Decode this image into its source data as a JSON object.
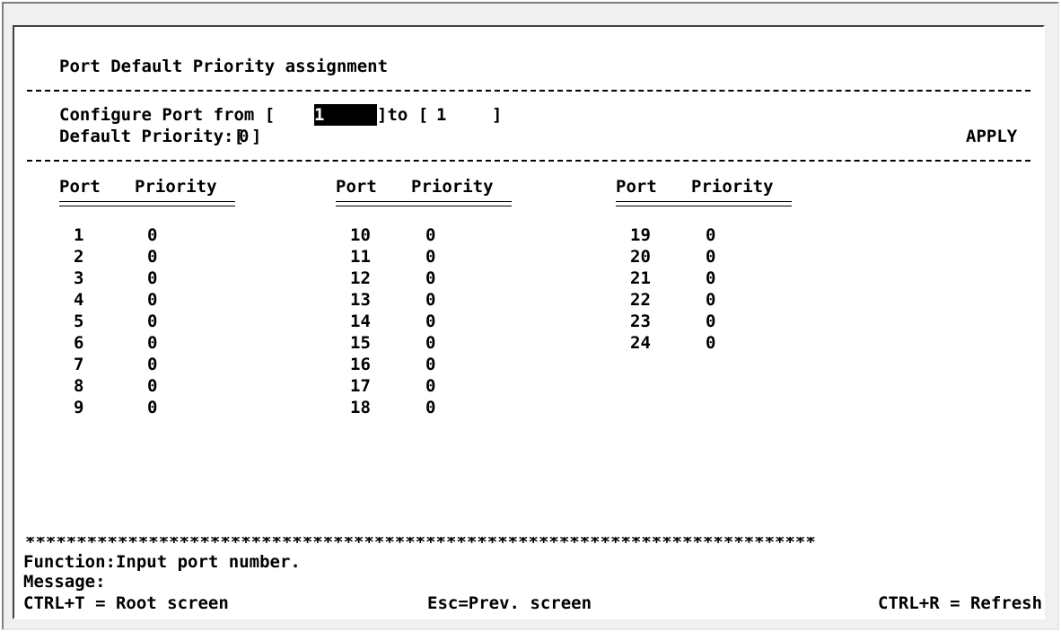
{
  "screen": {
    "title": "Port Default Priority assignment",
    "configure": {
      "label_from": "Configure Port from [",
      "from_value": "1",
      "label_to": "]to [",
      "to_value": "1   ",
      "label_close": "]"
    },
    "default_priority": {
      "label": "Default Priority:[",
      "value": "0",
      "label_close": "]"
    },
    "apply_label": "APPLY",
    "table": {
      "header_port": "Port",
      "header_priority": "Priority",
      "columns": [
        {
          "rows": [
            {
              "port": "1",
              "priority": "0"
            },
            {
              "port": "2",
              "priority": "0"
            },
            {
              "port": "3",
              "priority": "0"
            },
            {
              "port": "4",
              "priority": "0"
            },
            {
              "port": "5",
              "priority": "0"
            },
            {
              "port": "6",
              "priority": "0"
            },
            {
              "port": "7",
              "priority": "0"
            },
            {
              "port": "8",
              "priority": "0"
            },
            {
              "port": "9",
              "priority": "0"
            }
          ]
        },
        {
          "rows": [
            {
              "port": "10",
              "priority": "0"
            },
            {
              "port": "11",
              "priority": "0"
            },
            {
              "port": "12",
              "priority": "0"
            },
            {
              "port": "13",
              "priority": "0"
            },
            {
              "port": "14",
              "priority": "0"
            },
            {
              "port": "15",
              "priority": "0"
            },
            {
              "port": "16",
              "priority": "0"
            },
            {
              "port": "17",
              "priority": "0"
            },
            {
              "port": "18",
              "priority": "0"
            }
          ]
        },
        {
          "rows": [
            {
              "port": "19",
              "priority": "0"
            },
            {
              "port": "20",
              "priority": "0"
            },
            {
              "port": "21",
              "priority": "0"
            },
            {
              "port": "22",
              "priority": "0"
            },
            {
              "port": "23",
              "priority": "0"
            },
            {
              "port": "24",
              "priority": "0"
            }
          ]
        }
      ]
    },
    "separator_stars": "*****************************************************************************",
    "function_text": "Function:Input port number.",
    "message_text": "Message:",
    "shortcuts": {
      "root": "CTRL+T = Root screen",
      "prev": "Esc=Prev. screen",
      "refresh": "CTRL+R = Refresh"
    }
  }
}
